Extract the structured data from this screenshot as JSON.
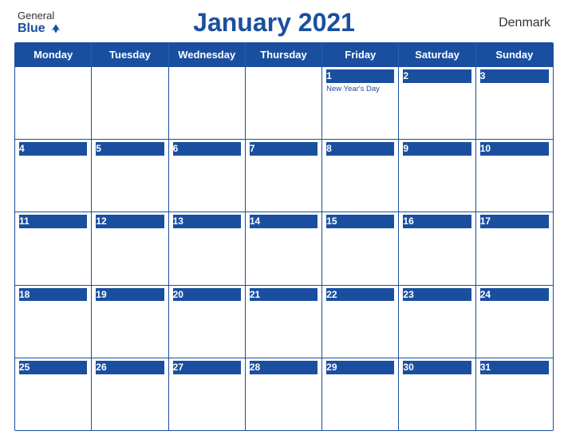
{
  "header": {
    "logo_general": "General",
    "logo_blue": "Blue",
    "title": "January 2021",
    "country": "Denmark"
  },
  "calendar": {
    "days_of_week": [
      "Monday",
      "Tuesday",
      "Wednesday",
      "Thursday",
      "Friday",
      "Saturday",
      "Sunday"
    ],
    "weeks": [
      [
        {
          "day": "",
          "holiday": ""
        },
        {
          "day": "",
          "holiday": ""
        },
        {
          "day": "",
          "holiday": ""
        },
        {
          "day": "",
          "holiday": ""
        },
        {
          "day": "1",
          "holiday": "New Year's Day"
        },
        {
          "day": "2",
          "holiday": ""
        },
        {
          "day": "3",
          "holiday": ""
        }
      ],
      [
        {
          "day": "4",
          "holiday": ""
        },
        {
          "day": "5",
          "holiday": ""
        },
        {
          "day": "6",
          "holiday": ""
        },
        {
          "day": "7",
          "holiday": ""
        },
        {
          "day": "8",
          "holiday": ""
        },
        {
          "day": "9",
          "holiday": ""
        },
        {
          "day": "10",
          "holiday": ""
        }
      ],
      [
        {
          "day": "11",
          "holiday": ""
        },
        {
          "day": "12",
          "holiday": ""
        },
        {
          "day": "13",
          "holiday": ""
        },
        {
          "day": "14",
          "holiday": ""
        },
        {
          "day": "15",
          "holiday": ""
        },
        {
          "day": "16",
          "holiday": ""
        },
        {
          "day": "17",
          "holiday": ""
        }
      ],
      [
        {
          "day": "18",
          "holiday": ""
        },
        {
          "day": "19",
          "holiday": ""
        },
        {
          "day": "20",
          "holiday": ""
        },
        {
          "day": "21",
          "holiday": ""
        },
        {
          "day": "22",
          "holiday": ""
        },
        {
          "day": "23",
          "holiday": ""
        },
        {
          "day": "24",
          "holiday": ""
        }
      ],
      [
        {
          "day": "25",
          "holiday": ""
        },
        {
          "day": "26",
          "holiday": ""
        },
        {
          "day": "27",
          "holiday": ""
        },
        {
          "day": "28",
          "holiday": ""
        },
        {
          "day": "29",
          "holiday": ""
        },
        {
          "day": "30",
          "holiday": ""
        },
        {
          "day": "31",
          "holiday": ""
        }
      ]
    ]
  }
}
